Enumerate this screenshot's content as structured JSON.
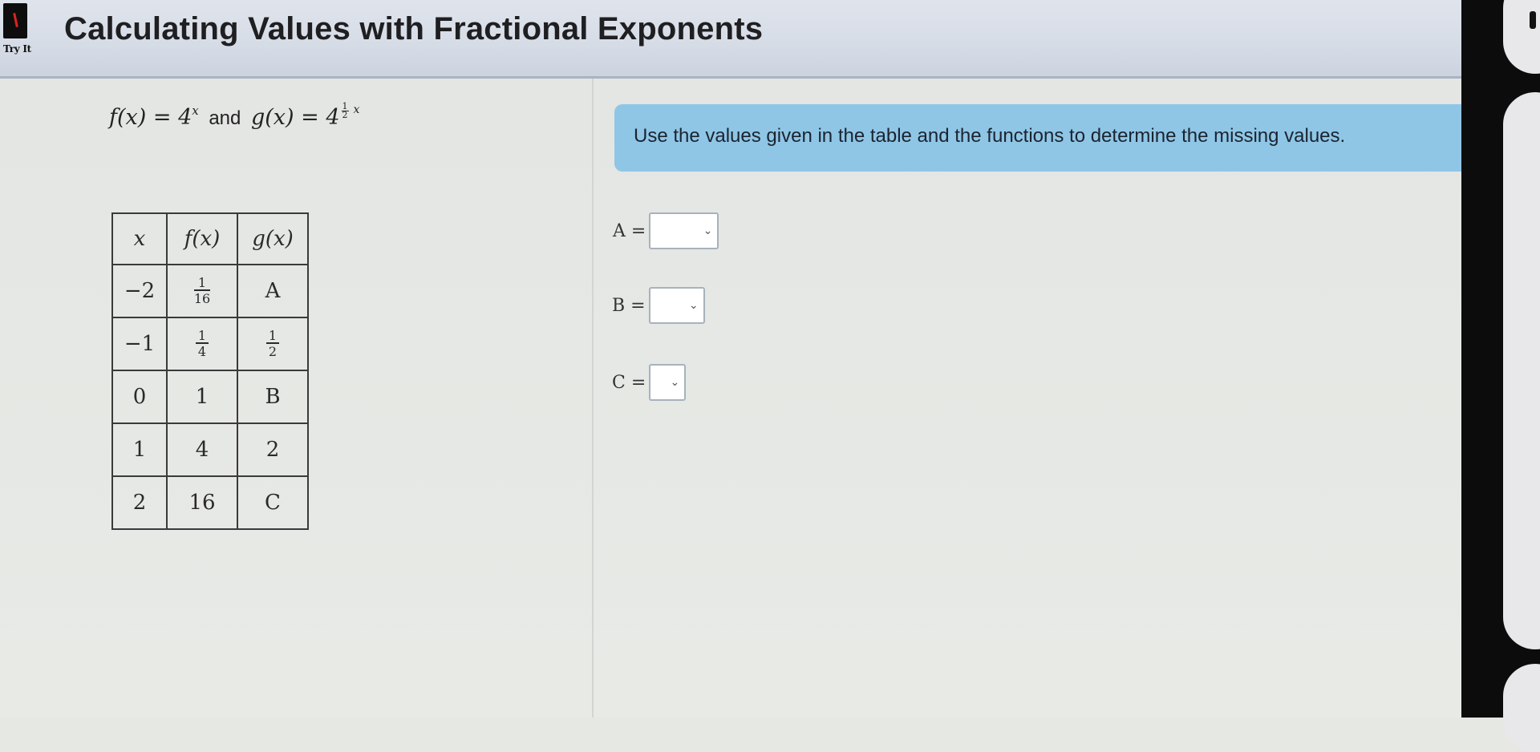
{
  "header": {
    "title": "Calculating Values with Fractional Exponents",
    "badge": "Try It"
  },
  "formula": {
    "f": "f(x) = 4",
    "f_exp": "x",
    "and": "and",
    "g": "g(x) = 4",
    "g_exp_num": "1",
    "g_exp_den": "2",
    "g_exp_var": "x"
  },
  "table": {
    "headers": [
      "x",
      "f(x)",
      "g(x)"
    ],
    "rows": [
      {
        "x": "−2",
        "f_num": "1",
        "f_den": "16",
        "g": "A"
      },
      {
        "x": "−1",
        "f_num": "1",
        "f_den": "4",
        "g_num": "1",
        "g_den": "2"
      },
      {
        "x": "0",
        "f": "1",
        "g": "B"
      },
      {
        "x": "1",
        "f": "4",
        "g": "2"
      },
      {
        "x": "2",
        "f": "16",
        "g": "C"
      }
    ]
  },
  "instruction": "Use the values given in the table and the functions to determine the missing values.",
  "answers": [
    {
      "label": "A =",
      "value": ""
    },
    {
      "label": "B =",
      "value": ""
    },
    {
      "label": "C =",
      "value": ""
    }
  ],
  "icons": {
    "dropdown": "chevron-down-icon",
    "brand": "logo-icon"
  }
}
